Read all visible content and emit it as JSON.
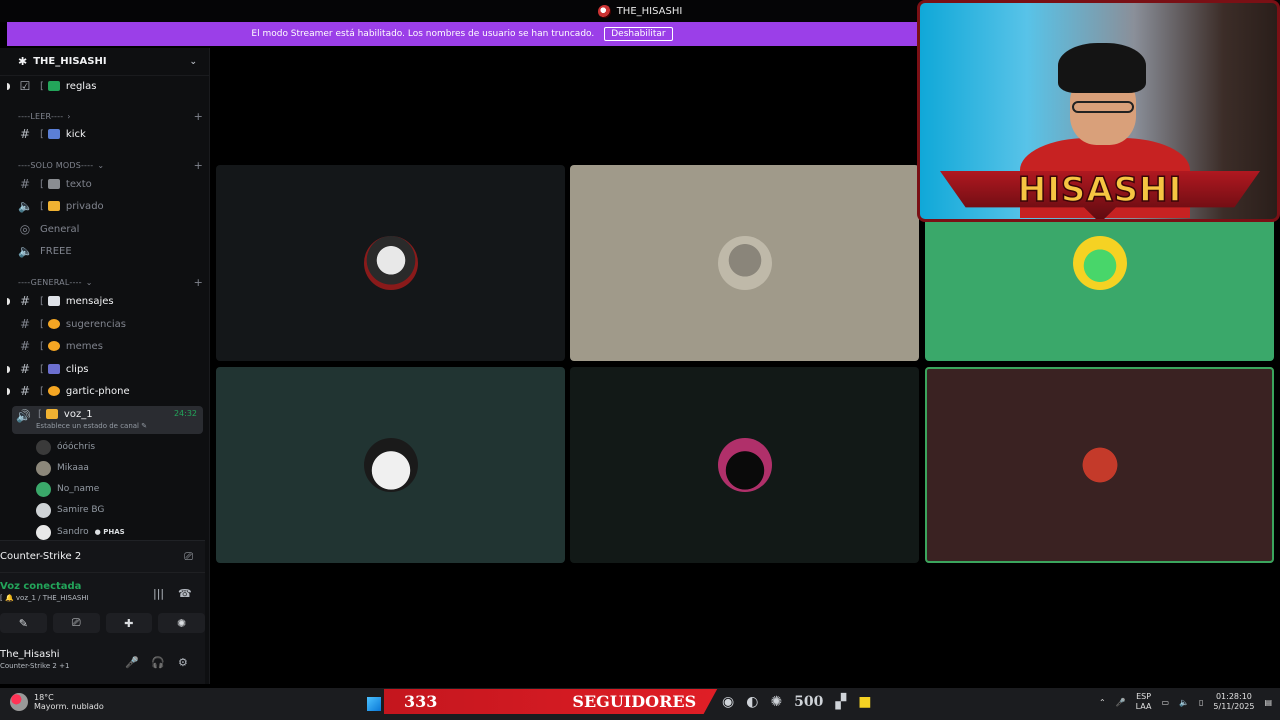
{
  "window": {
    "title": "THE_HISASHI"
  },
  "streamer_banner": {
    "text": "El modo Streamer está habilitado. Los nombres de usuario se han truncado.",
    "button": "Deshabilitar"
  },
  "server": {
    "name": "THE_HISASHI"
  },
  "channels": [
    {
      "name": "reglas",
      "bracket": "[",
      "unread": true
    },
    {
      "category": "----LEER----"
    },
    {
      "name": "kick",
      "bracket": "[",
      "unread": true
    },
    {
      "category": "----SOLO MODS----"
    },
    {
      "name": "texto",
      "bracket": "[",
      "unread": false
    },
    {
      "name": "privado",
      "bracket": "[",
      "unread": false
    },
    {
      "name": "General",
      "unread": false
    },
    {
      "name": "FREEE",
      "unread": false
    },
    {
      "category": "----GENERAL----"
    },
    {
      "name": "mensajes",
      "bracket": "[",
      "unread": true
    },
    {
      "name": "sugerencias",
      "bracket": "[",
      "unread": false
    },
    {
      "name": "memes",
      "bracket": "[",
      "unread": false
    },
    {
      "name": "clips",
      "bracket": "[",
      "unread": true
    },
    {
      "name": "gartic-phone",
      "bracket": "[",
      "unread": true
    }
  ],
  "active_voice": {
    "name": "voz_1",
    "bracket": "[",
    "time": "24:32",
    "status": "Establece un estado de canal"
  },
  "voice_users": [
    {
      "name": "óóóchris"
    },
    {
      "name": "Mikaaa"
    },
    {
      "name": "No_name"
    },
    {
      "name": "Samire BG"
    },
    {
      "name": "Sandro",
      "tag": "PHAS"
    }
  ],
  "activity": {
    "game": "Counter-Strike 2"
  },
  "voice_status": {
    "label": "Voz conectada",
    "path": "[ 🔔 voz_1 / THE_HISASHI"
  },
  "user": {
    "name": "The_Hisashi",
    "status": "Counter-Strike 2 +1"
  },
  "stream_overlay": {
    "name_banner": "HISASHI",
    "followers_count": "333",
    "followers_label": "SEGUIDORES",
    "goal": "500"
  },
  "taskbar": {
    "temp": "18°C",
    "weather": "Mayorm. nublado",
    "lang1": "ESP",
    "lang2": "LAA",
    "time": "01:28:10",
    "date": "5/11/2025"
  },
  "tile_colors": {
    "t1": "#141719",
    "t2": "#a09a8a",
    "t3": "#3aa86a",
    "t4": "#213432",
    "t5": "#121917",
    "t6": "#3a2222"
  },
  "accent": "#9b3fe8"
}
